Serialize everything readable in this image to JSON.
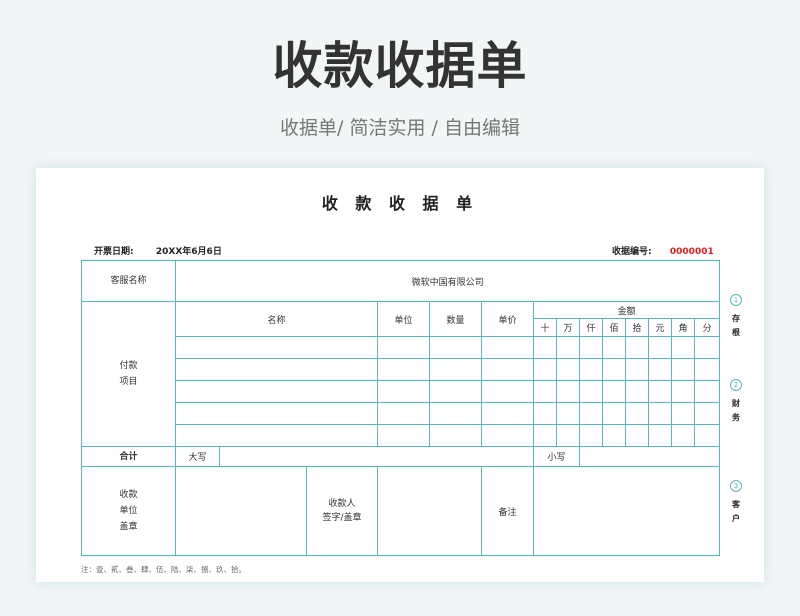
{
  "banner": {
    "title": "收款收据单",
    "subtitle": "收据单/ 简洁实用 / 自由编辑"
  },
  "doc": {
    "title": "收 款 收 据 单",
    "issue_date_label": "开票日期:",
    "issue_date_value": "20XX年6月6日",
    "receipt_no_label": "收据编号:",
    "receipt_no_value": "0000001",
    "accent_color": "#5bb6bb",
    "number_color": "#e02020"
  },
  "table": {
    "customer_label": "客服名称",
    "customer_value": "微软中国有限公司",
    "payment_items_label": [
      "付款",
      "项目"
    ],
    "headers": {
      "name": "名称",
      "unit": "单位",
      "quantity": "数量",
      "unit_price": "单价",
      "amount": "金额"
    },
    "digits": [
      "十",
      "万",
      "仟",
      "佰",
      "拾",
      "元",
      "角",
      "分"
    ],
    "total_label": "合计",
    "uppercase_label": "大写",
    "lowercase_label": "小写",
    "payee_unit_label": [
      "收款",
      "单位",
      "盖章"
    ],
    "receiver_label": [
      "收款人",
      "签字/盖章"
    ],
    "remark_label": "备注"
  },
  "side_labels": [
    {
      "num": "1",
      "chars": [
        "存",
        "根"
      ]
    },
    {
      "num": "2",
      "chars": [
        "财",
        "务"
      ]
    },
    {
      "num": "3",
      "chars": [
        "客",
        "户"
      ]
    }
  ],
  "note": "注：壹、貳、叁、肆、伍、陆、柒、捌、玖、拾。"
}
